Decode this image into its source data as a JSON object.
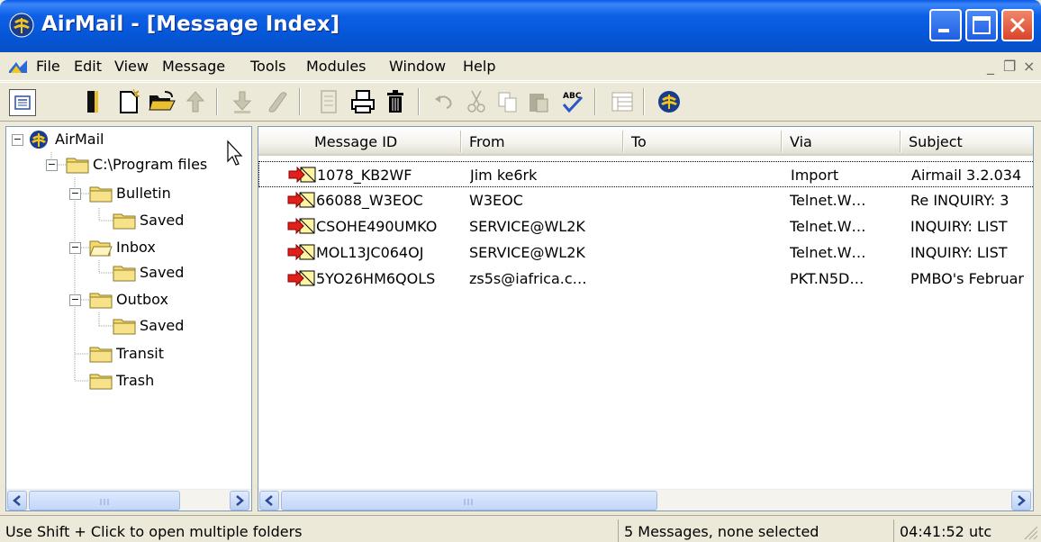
{
  "window": {
    "title": "AirMail - [Message Index]"
  },
  "menu": {
    "items": [
      "File",
      "Edit",
      "View",
      "Message",
      "Tools",
      "Modules",
      "Window",
      "Help"
    ],
    "mdi_minimize": "_",
    "mdi_restore": "❐",
    "mdi_close": "×"
  },
  "folders": {
    "root": "AirMail",
    "program_files": "C:\\Program files",
    "bulletin": "Bulletin",
    "bulletin_saved": "Saved",
    "inbox": "Inbox",
    "inbox_saved": "Saved",
    "outbox": "Outbox",
    "outbox_saved": "Saved",
    "transit": "Transit",
    "trash": "Trash"
  },
  "messages": {
    "columns": [
      "Message ID",
      "From",
      "To",
      "Via",
      "Subject"
    ],
    "rows": [
      {
        "id": "1078_KB2WF",
        "from": "Jim ke6rk",
        "to": "",
        "via": "Import",
        "subject": "Airmail 3.2.034"
      },
      {
        "id": "66088_W3EOC",
        "from": "W3EOC",
        "to": "",
        "via": "Telnet.W…",
        "subject": "Re INQUIRY: 3"
      },
      {
        "id": "CSOHE490UMKO",
        "from": "SERVICE@WL2K",
        "to": "",
        "via": "Telnet.W…",
        "subject": "INQUIRY: LIST"
      },
      {
        "id": "MOL13JC064OJ",
        "from": "SERVICE@WL2K",
        "to": "",
        "via": "Telnet.W…",
        "subject": "INQUIRY: LIST"
      },
      {
        "id": "5YO26HM6QOLS",
        "from": "zs5s@iafrica.c…",
        "to": "",
        "via": "PKT.N5D…",
        "subject": "PMBO's Februar"
      }
    ]
  },
  "status": {
    "hint": "Use Shift + Click to open multiple folders",
    "count": "5 Messages, none selected",
    "time": "04:41:52 utc"
  },
  "colors": {
    "titlebar": "#0556d6",
    "chrome": "#ece9d8",
    "folder": "#f5d96b",
    "message_arrow": "#e0201a"
  }
}
